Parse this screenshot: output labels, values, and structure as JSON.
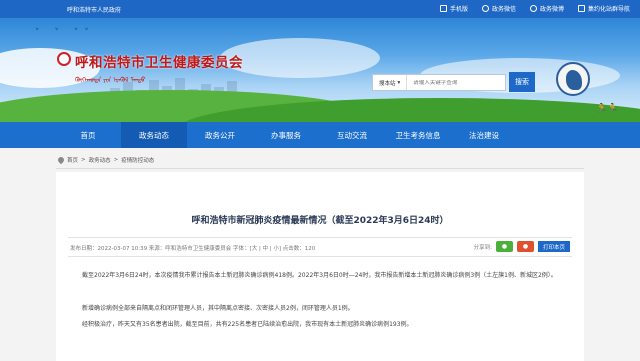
{
  "topbar": {
    "site_name": "呼和浩特市人民政府",
    "links": [
      {
        "icon": "mobile-icon",
        "label": "手机版"
      },
      {
        "icon": "wechat-icon",
        "label": "政务微信"
      },
      {
        "icon": "weibo-icon",
        "label": "政务微博"
      },
      {
        "icon": "app-icon",
        "label": "集约化站群导航"
      }
    ]
  },
  "banner": {
    "title": "呼和浩特市卫生健康委员会",
    "mongolian": "ᠬᠥᠬᠡᠬᠣᠲᠠ ᠶᠢᠨ ᠡᠷᠡᠭᠦᠯ ᠮᠡᠨᠳᠦ",
    "search_scope": "搜本站",
    "search_placeholder": "请输入关键字查询",
    "search_button": "搜索"
  },
  "nav": {
    "items": [
      "首页",
      "政务动态",
      "政务公开",
      "办事服务",
      "互动交流",
      "卫生考务信息",
      "法治建设"
    ],
    "active_index": 1
  },
  "breadcrumb": [
    "首页",
    "政务动态",
    "疫情防控动态"
  ],
  "article": {
    "title": "呼和浩特市新冠肺炎疫情最新情况（截至2022年3月6日24时）",
    "meta": "发布日期：2022-03-07 10:39   来源：呼和浩特市卫生健康委员会   字体：[大 | 中 | 小]   点击数：120",
    "share_label": "分享到:",
    "print_button": "打印本页",
    "paragraphs": [
      "截至2022年3月6日24时，本次疫情我市累计报告本土新冠肺炎确诊病例418例。2022年3月6日0时—24时，我市报告新增本土新冠肺炎确诊病例3例（土左旗1例、新城区2例）。",
      "新增确诊病例全部来自隔离点和闭环管理人员，其中隔离点密接、次密接人员2例，闭环管理人员1例。",
      "经积极治疗，昨天又有35名患者出院，截至目前，共有225名患者已陆续治愈出院，我市现有本土新冠肺炎确诊病例193例。"
    ]
  },
  "colors": {
    "topbar": "#1f67c4",
    "nav": "#1d6fce",
    "nav_active": "#135bb3",
    "title_red": "#c01919"
  }
}
